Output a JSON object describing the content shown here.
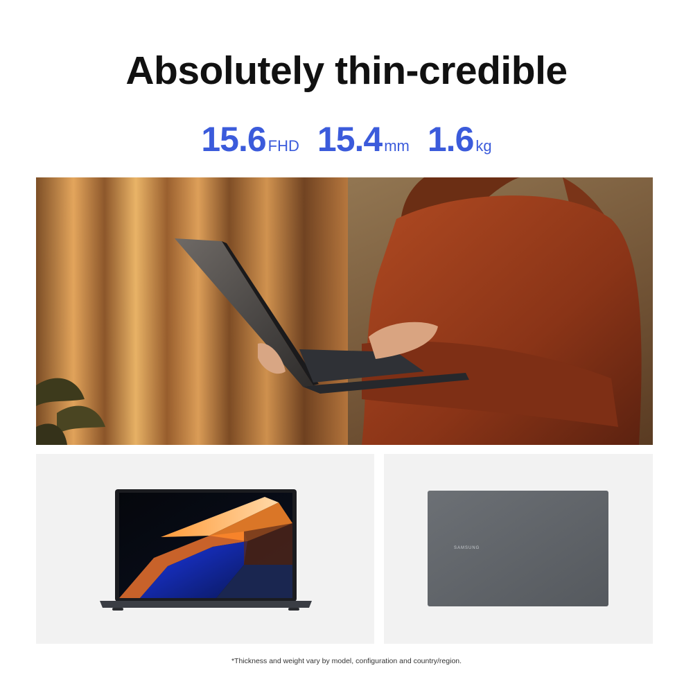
{
  "headline": "Absolutely thin-credible",
  "specs": [
    {
      "value": "15.6",
      "unit": "FHD"
    },
    {
      "value": "15.4",
      "unit": "mm"
    },
    {
      "value": "1.6",
      "unit": "kg"
    }
  ],
  "laptop_lid_brand": "SAMSUNG",
  "disclaimer": "*Thickness and weight vary by model, configuration and country/region.",
  "colors": {
    "accent": "#3b5bdb",
    "headline": "#111111",
    "panel_bg": "#f2f2f2",
    "lid": "#5f6368"
  }
}
